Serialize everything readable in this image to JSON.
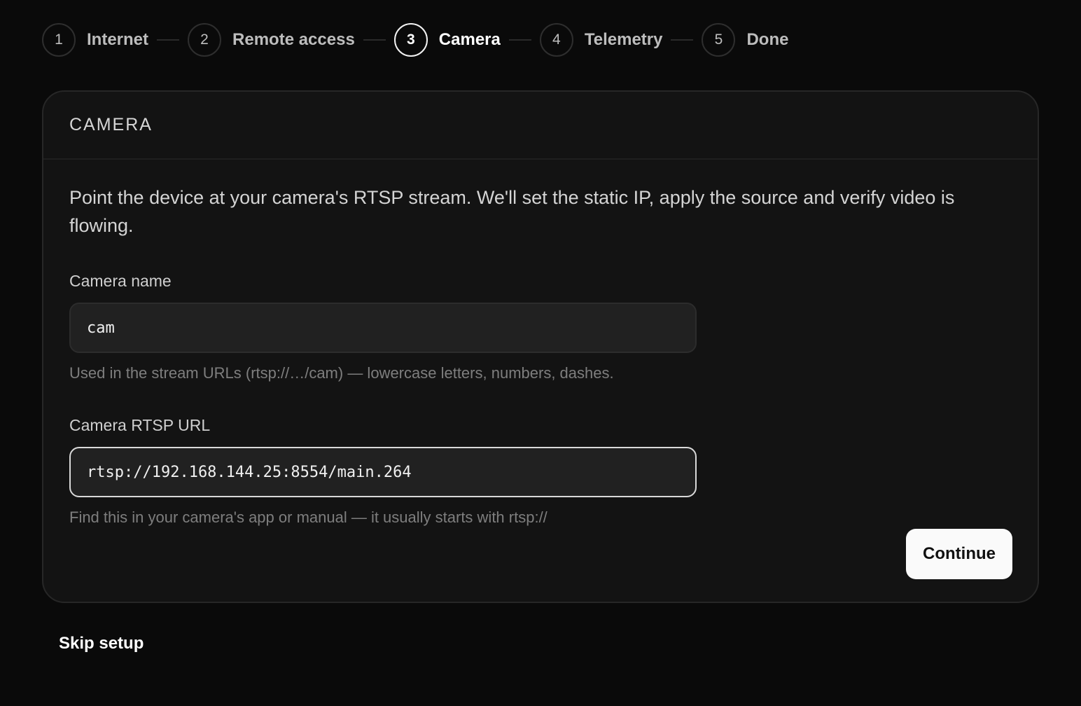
{
  "stepper": {
    "steps": [
      {
        "number": "1",
        "label": "Internet"
      },
      {
        "number": "2",
        "label": "Remote access"
      },
      {
        "number": "3",
        "label": "Camera"
      },
      {
        "number": "4",
        "label": "Telemetry"
      },
      {
        "number": "5",
        "label": "Done"
      }
    ],
    "active_step": "3"
  },
  "card": {
    "title": "CAMERA",
    "intro": "Point the device at your camera's RTSP stream. We'll set the static IP, apply the source and verify video is flowing.",
    "camera_name": {
      "label": "Camera name",
      "value": "cam",
      "hint": "Used in the stream URLs (rtsp://…/cam) — lowercase letters, numbers, dashes."
    },
    "rtsp_url": {
      "label": "Camera RTSP URL",
      "value": "rtsp://192.168.144.25:8554/main.264",
      "hint": "Find this in your camera's app or manual — it usually starts with rtsp://"
    },
    "continue_label": "Continue"
  },
  "skip_label": "Skip setup",
  "colors": {
    "background": "#0a0a0a",
    "card": "#131313",
    "input": "#212121",
    "primary_button": "#fafafa",
    "hint_text": "#7e7e7e"
  }
}
